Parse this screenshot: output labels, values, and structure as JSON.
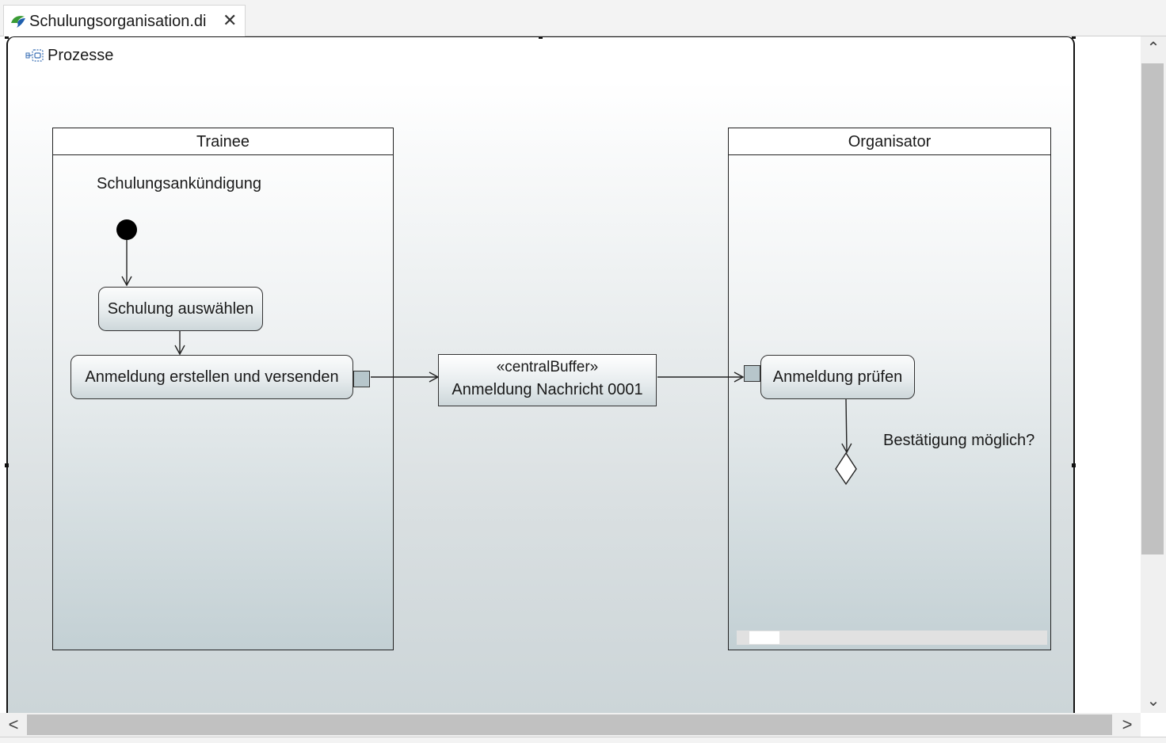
{
  "tab": {
    "title": "Schulungsorganisation.di",
    "close_glyph": "✕",
    "icon": "papyrus-icon"
  },
  "diagram": {
    "title": "Prozesse",
    "title_icon": "activity-diagram-icon",
    "partitions": [
      {
        "name": "Trainee"
      },
      {
        "name": "Organisator"
      }
    ],
    "activity_label": "Schulungsankündigung",
    "actions": {
      "select": "Schulung auswählen",
      "create_send": "Anmeldung erstellen und versenden",
      "check": "Anmeldung prüfen"
    },
    "buffer": {
      "stereotype": "«centralBuffer»",
      "name": "Anmeldung Nachricht 0001"
    },
    "decision_label": "Bestätigung möglich?"
  },
  "scrollbars": {
    "up": "⌃",
    "down": "⌄",
    "left": "<",
    "right": ">"
  },
  "colors": {
    "accent_green": "#3a9b35",
    "pin_fill": "#b7c6cb"
  }
}
